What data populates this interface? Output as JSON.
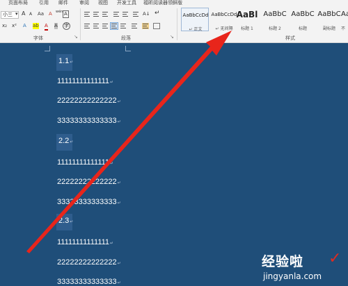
{
  "ribbon": {
    "tabs": [
      "页面布局",
      "引用",
      "邮件",
      "审阅",
      "视图",
      "开发工具",
      "福昕阅读器领鲜版"
    ],
    "font": {
      "size_value": "小三",
      "size_dropdown": "▾",
      "grow": "A",
      "shrink": "A",
      "case_label": "Aa",
      "clear_format": "A",
      "pinyin": "wén",
      "border_char": "A",
      "group_label": "字体",
      "launcher": "↘",
      "row2": {
        "subscript": "x₂",
        "superscript": "x²",
        "text_effect": "A",
        "highlight": "ab",
        "font_color": "A",
        "char_shade": "A",
        "enclose": "字"
      }
    },
    "paragraph": {
      "group_label": "段落",
      "launcher": "↘",
      "sort": "A↓",
      "show_marks": "↵"
    },
    "styles": {
      "group_label": "样式",
      "items": [
        {
          "sample": "AaBbCcDd",
          "name": "↵ 正文"
        },
        {
          "sample": "AaBbCcDd",
          "name": "↵ 无间隔"
        },
        {
          "sample": "AaBl",
          "name": "标题 1"
        },
        {
          "sample": "AaBbC",
          "name": "标题 2"
        },
        {
          "sample": "AaBbC",
          "name": "标题"
        },
        {
          "sample": "AaBbC",
          "name": "副标题"
        },
        {
          "sample": "AaBbC",
          "name": "不"
        }
      ]
    }
  },
  "document": {
    "para_mark": "↵",
    "lines": [
      {
        "kind": "heading",
        "text": "1.1"
      },
      {
        "kind": "body",
        "text": "11111111111111"
      },
      {
        "kind": "body",
        "text": "22222222222222"
      },
      {
        "kind": "body",
        "text": "33333333333333"
      },
      {
        "kind": "heading",
        "text": "2.2"
      },
      {
        "kind": "body",
        "text": "11111111111111"
      },
      {
        "kind": "body",
        "text": "22222222222222"
      },
      {
        "kind": "body",
        "text": "33333333333333"
      },
      {
        "kind": "heading",
        "text": "2.3"
      },
      {
        "kind": "body",
        "text": "11111111111111"
      },
      {
        "kind": "body",
        "text": "22222222222222"
      },
      {
        "kind": "body",
        "text": "33333333333333"
      }
    ]
  },
  "watermark": {
    "title": "经验啦",
    "url": "jingyanla.com",
    "check": "✓"
  },
  "colors": {
    "document_bg": "#1f4e79",
    "heading_highlight": "#2f5d8d",
    "arrow": "#e8251b",
    "ribbon_bg": "#f3f3f3"
  }
}
